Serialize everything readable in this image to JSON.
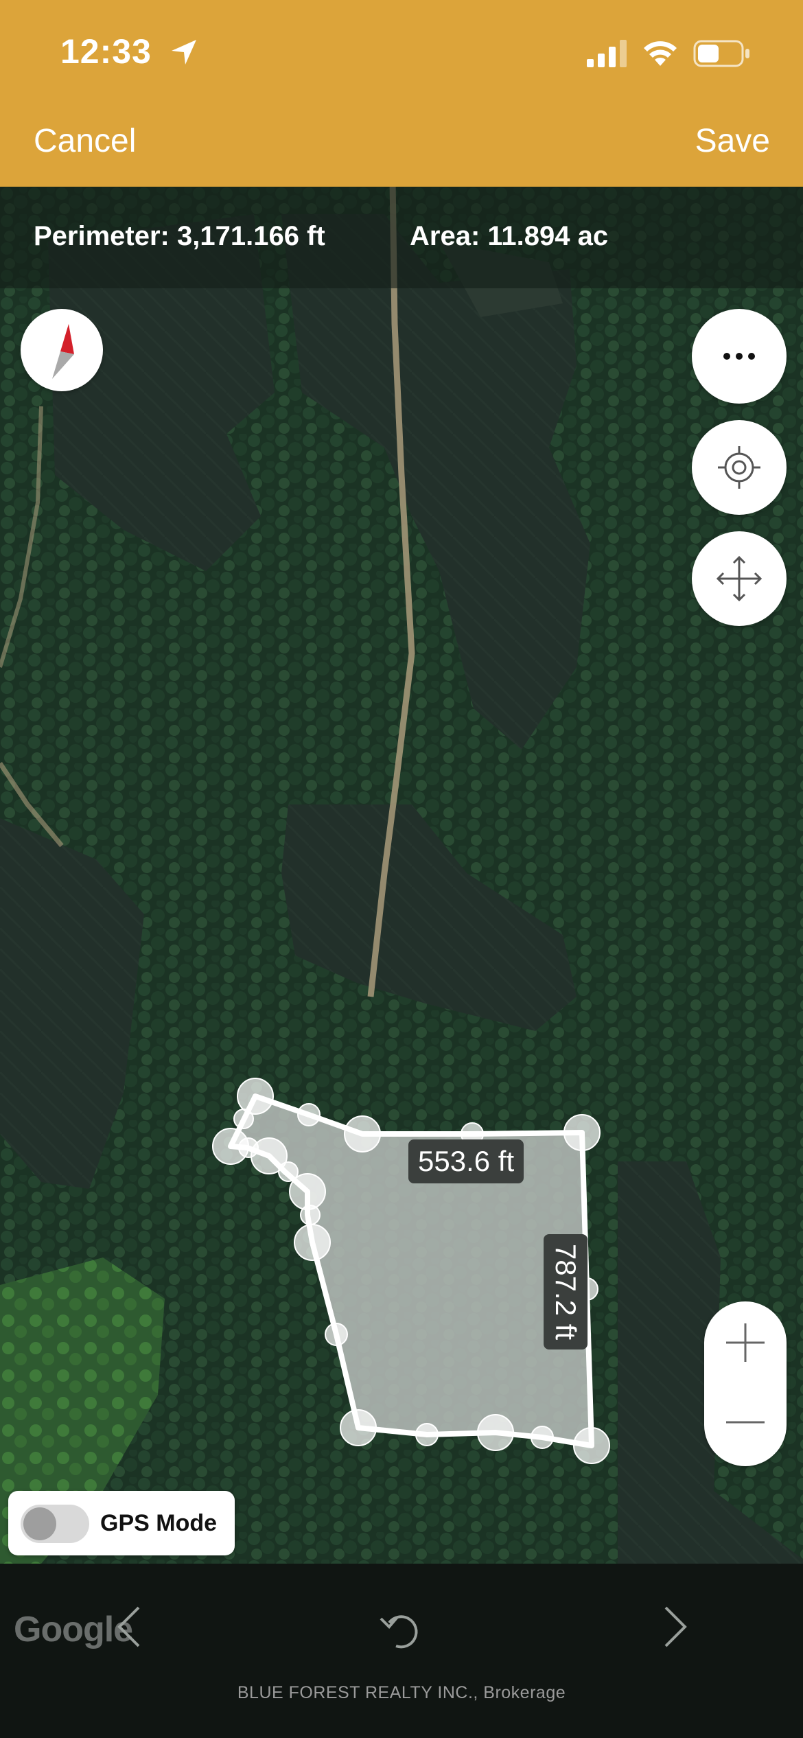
{
  "status": {
    "time": "12:33"
  },
  "nav": {
    "cancel_label": "Cancel",
    "save_label": "Save"
  },
  "measure_info": {
    "perimeter": "Perimeter: 3,171.166 ft",
    "area": "Area: 11.894 ac"
  },
  "segments": {
    "top_length": "553.6 ft",
    "right_length": "787.2 ft"
  },
  "gps": {
    "label": "GPS Mode",
    "enabled": false
  },
  "map": {
    "provider_watermark": "Google"
  },
  "footer": {
    "text": "BLUE FOREST REALTY INC., Brokerage"
  },
  "colors": {
    "accent": "#dca43a",
    "polygon_fill": "#b9bebb",
    "compass_red": "#d3202a"
  },
  "icons": [
    "location-arrow-icon",
    "signal-icon",
    "wifi-icon",
    "battery-icon",
    "compass-icon",
    "more-icon",
    "locate-icon",
    "move-icon",
    "zoom-in-icon",
    "zoom-out-icon",
    "back-icon",
    "undo-icon",
    "forward-icon"
  ]
}
